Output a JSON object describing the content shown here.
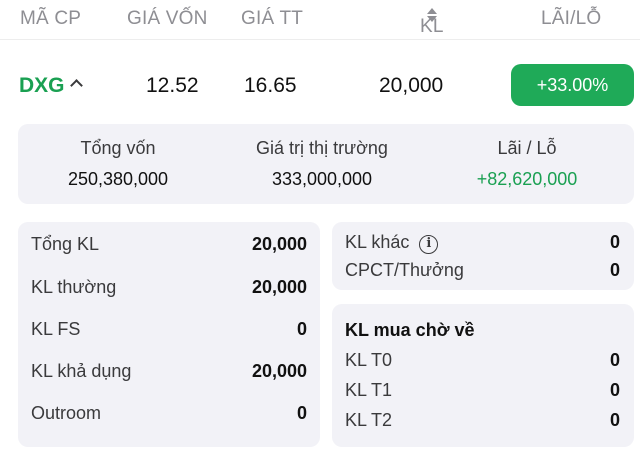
{
  "header": {
    "code": "MÃ CP",
    "cost_price": "GIÁ VỐN",
    "market_price": "GIÁ TT",
    "volume": "KL",
    "profit_loss": "LÃI/LỖ"
  },
  "holding": {
    "code": "DXG",
    "cost_price": "12.52",
    "market_price": "16.65",
    "volume": "20,000",
    "profit_loss_pct": "+33.00%"
  },
  "summary": {
    "total_capital_label": "Tổng vốn",
    "total_capital": "250,380,000",
    "market_value_label": "Giá trị thị trường",
    "market_value": "333,000,000",
    "pl_label": "Lãi / Lỗ",
    "pl_value": "+82,620,000"
  },
  "left_card": [
    {
      "label": "Tổng KL",
      "value": "20,000"
    },
    {
      "label": "KL thường",
      "value": "20,000"
    },
    {
      "label": "KL FS",
      "value": "0"
    },
    {
      "label": "KL khả dụng",
      "value": "20,000"
    },
    {
      "label": "Outroom",
      "value": "0"
    }
  ],
  "right_top": {
    "other_label": "KL khác",
    "other_value": "0",
    "dividend_label": "CPCT/Thưởng",
    "dividend_value": "0"
  },
  "right_bottom": {
    "title": "KL mua chờ về",
    "items": [
      {
        "label": "KL T0",
        "value": "0"
      },
      {
        "label": "KL T1",
        "value": "0"
      },
      {
        "label": "KL T2",
        "value": "0"
      }
    ]
  },
  "colors": {
    "green": "#1aa052",
    "pl_button": "#1faa58",
    "card_bg": "#f2f2f7"
  },
  "icons": [
    "chevron-up-icon",
    "sort-icon",
    "info-icon"
  ]
}
